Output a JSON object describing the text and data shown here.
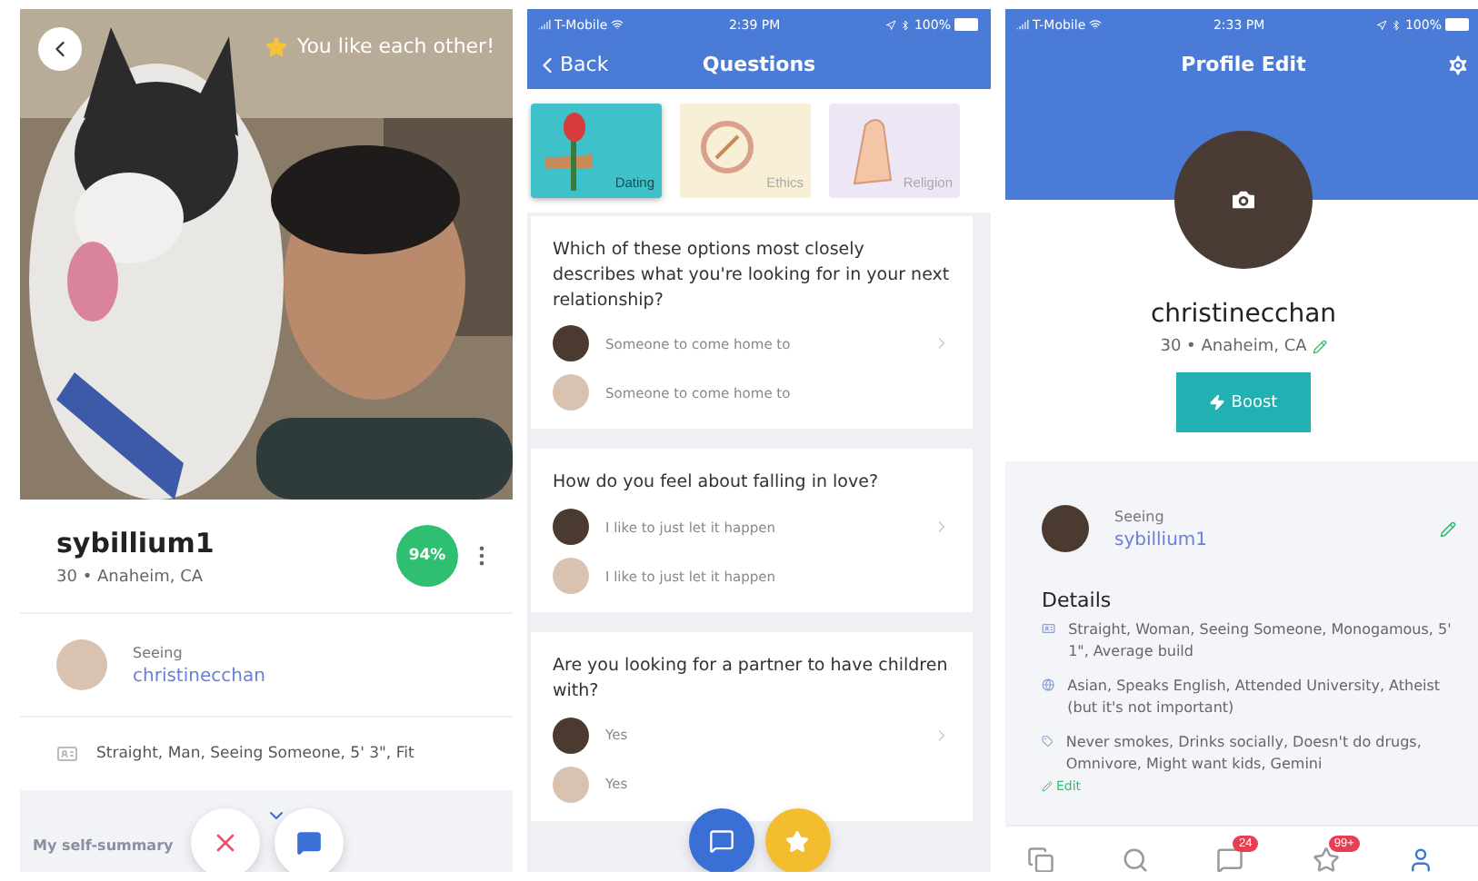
{
  "match_profile": {
    "banner": "You like each other!",
    "username": "sybillium1",
    "location": "30 • Anaheim, CA",
    "match_percent": "94%",
    "seeing": {
      "label": "Seeing",
      "name": "christinecchan"
    },
    "details": "Straight, Man, Seeing Someone, 5' 3\", Fit",
    "section_title": "My self-summary"
  },
  "questions_screen": {
    "status_bar": {
      "carrier": "T-Mobile",
      "time": "2:39 PM",
      "battery": "100%"
    },
    "back": "Back",
    "title": "Questions",
    "categories": [
      {
        "label": "Dating",
        "selected": true,
        "color": "#3ec1c9"
      },
      {
        "label": "Ethics",
        "selected": false,
        "color": "#f7efd6"
      },
      {
        "label": "Religion",
        "selected": false,
        "color": "#ece6f5"
      }
    ],
    "questions": [
      {
        "text": "Which of these options most closely describes what you're looking for in your next relationship?",
        "answers": [
          "Someone to come home to",
          "Someone to come home to"
        ]
      },
      {
        "text": "How do you feel about falling in love?",
        "answers": [
          "I like to just let it happen",
          "I like to just let it happen"
        ]
      },
      {
        "text": "Are you looking for a partner to have children with?",
        "answers": [
          "Yes",
          "Yes"
        ]
      }
    ]
  },
  "profile_edit": {
    "status_bar": {
      "carrier": "T-Mobile",
      "time": "2:33 PM",
      "battery": "100%"
    },
    "title": "Profile Edit",
    "username": "christinecchan",
    "location": "30 • Anaheim, CA",
    "boost": "Boost",
    "seeing": {
      "label": "Seeing",
      "name": "sybillium1"
    },
    "details_title": "Details",
    "details": [
      {
        "kind": "identity",
        "text": "Straight, Woman, Seeing Someone, Monogamous, 5' 1\", Average build"
      },
      {
        "kind": "background",
        "text": "Asian, Speaks English, Attended University, Atheist (but it's not important)"
      },
      {
        "kind": "habits",
        "text": "Never smokes, Drinks socially, Doesn't do drugs, Omnivore, Might want kids, Gemini"
      }
    ],
    "edit": "Edit",
    "tabs": [
      {
        "kind": "cards",
        "selected": false
      },
      {
        "kind": "search",
        "selected": false
      },
      {
        "kind": "messages",
        "badge": "24",
        "selected": false
      },
      {
        "kind": "likes",
        "badge": "99+",
        "selected": false
      },
      {
        "kind": "profile",
        "selected": true
      }
    ]
  }
}
